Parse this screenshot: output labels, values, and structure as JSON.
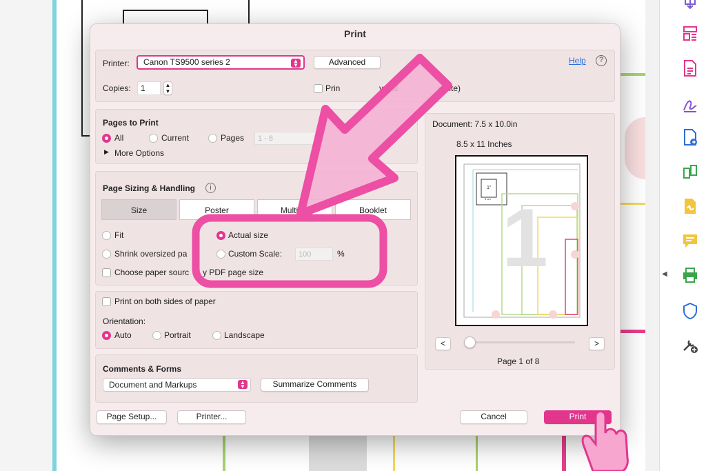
{
  "dialog": {
    "title": "Print",
    "printer_label": "Printer:",
    "printer_value": "Canon TS9500 series 2",
    "advanced_button": "Advanced",
    "help_link": "Help",
    "help_icon_glyph": "?",
    "copies_label": "Copies:",
    "copies_value": "1",
    "grayscale_label": "Print in grayscale (black & white)",
    "grayscale_visible_left": "Prin",
    "grayscale_visible_right": "white)",
    "grayscale_visible_mid": "yscal"
  },
  "pages_to_print": {
    "heading": "Pages to Print",
    "all": "All",
    "current": "Current",
    "pages": "Pages",
    "pages_range_placeholder": "1 - 8",
    "more_options": "More Options",
    "selected": "All"
  },
  "sizing": {
    "heading": "Page Sizing & Handling",
    "info_icon_glyph": "i",
    "tabs": [
      "Size",
      "Poster",
      "Multiple",
      "Booklet"
    ],
    "tabs_visible": [
      "Size",
      "Poster",
      "Multiple",
      "Booklet"
    ],
    "selected_tab": "Size",
    "fit": "Fit",
    "actual_size": "Actual size",
    "shrink": "Shrink oversized pa",
    "custom_scale": "Custom Scale:",
    "custom_scale_value": "100",
    "percent": "%",
    "choose_paper": "Choose paper sourc",
    "choose_paper_tail": "y PDF page size",
    "selected_option": "Actual size"
  },
  "duplex": {
    "both_sides": "Print on both sides of paper",
    "orientation_label": "Orientation:",
    "auto": "Auto",
    "portrait": "Portrait",
    "landscape": "Landscape",
    "selected": "Auto"
  },
  "comments": {
    "heading": "Comments & Forms",
    "select_value": "Document and Markups",
    "summarize_button": "Summarize Comments"
  },
  "preview": {
    "document_size": "Document: 7.5 x 10.0in",
    "paper_size": "8.5 x 11 Inches",
    "prev_button": "<",
    "next_button": ">",
    "page_indicator": "Page 1 of 8",
    "slider_position": 0,
    "thumb_label_inch": "1\"",
    "thumb_label_cm": "5 cm",
    "big_number": "1"
  },
  "footer": {
    "page_setup": "Page Setup...",
    "printer": "Printer...",
    "cancel": "Cancel",
    "print": "Print"
  },
  "colors": {
    "accent": "#e2368d",
    "annotation_pink": "#ec4fa3",
    "annotation_fill": "#f5b0d3"
  },
  "toolbar_icons": [
    "export-pdf-icon",
    "organize-pages-icon",
    "create-pdf-icon",
    "fill-sign-icon",
    "edit-pdf-icon",
    "compress-icon",
    "request-signature-icon",
    "comment-icon",
    "print-production-icon",
    "protect-icon",
    "more-tools-icon"
  ]
}
